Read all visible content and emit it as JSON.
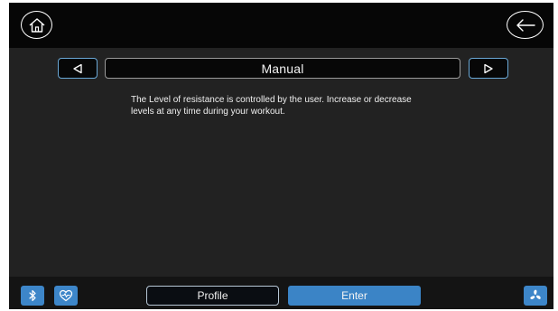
{
  "header": {
    "home_icon": "home-icon",
    "back_icon": "back-arrow-icon"
  },
  "program_selector": {
    "prev_icon": "triangle-left-icon",
    "next_icon": "triangle-right-icon",
    "current_program": "Manual"
  },
  "description": {
    "line1": "The Level of resistance is controlled by the user. Increase or decrease",
    "line2": "levels at any time during your workout."
  },
  "footer": {
    "bluetooth_icon": "bluetooth-icon",
    "heart_rate_icon": "heart-rate-icon",
    "profile_label": "Profile",
    "enter_label": "Enter",
    "fan_icon": "fan-icon"
  },
  "colors": {
    "accent": "#3d86c9",
    "arrow_border": "#6aa8d6",
    "background": "#222222",
    "topbar": "#060606"
  }
}
